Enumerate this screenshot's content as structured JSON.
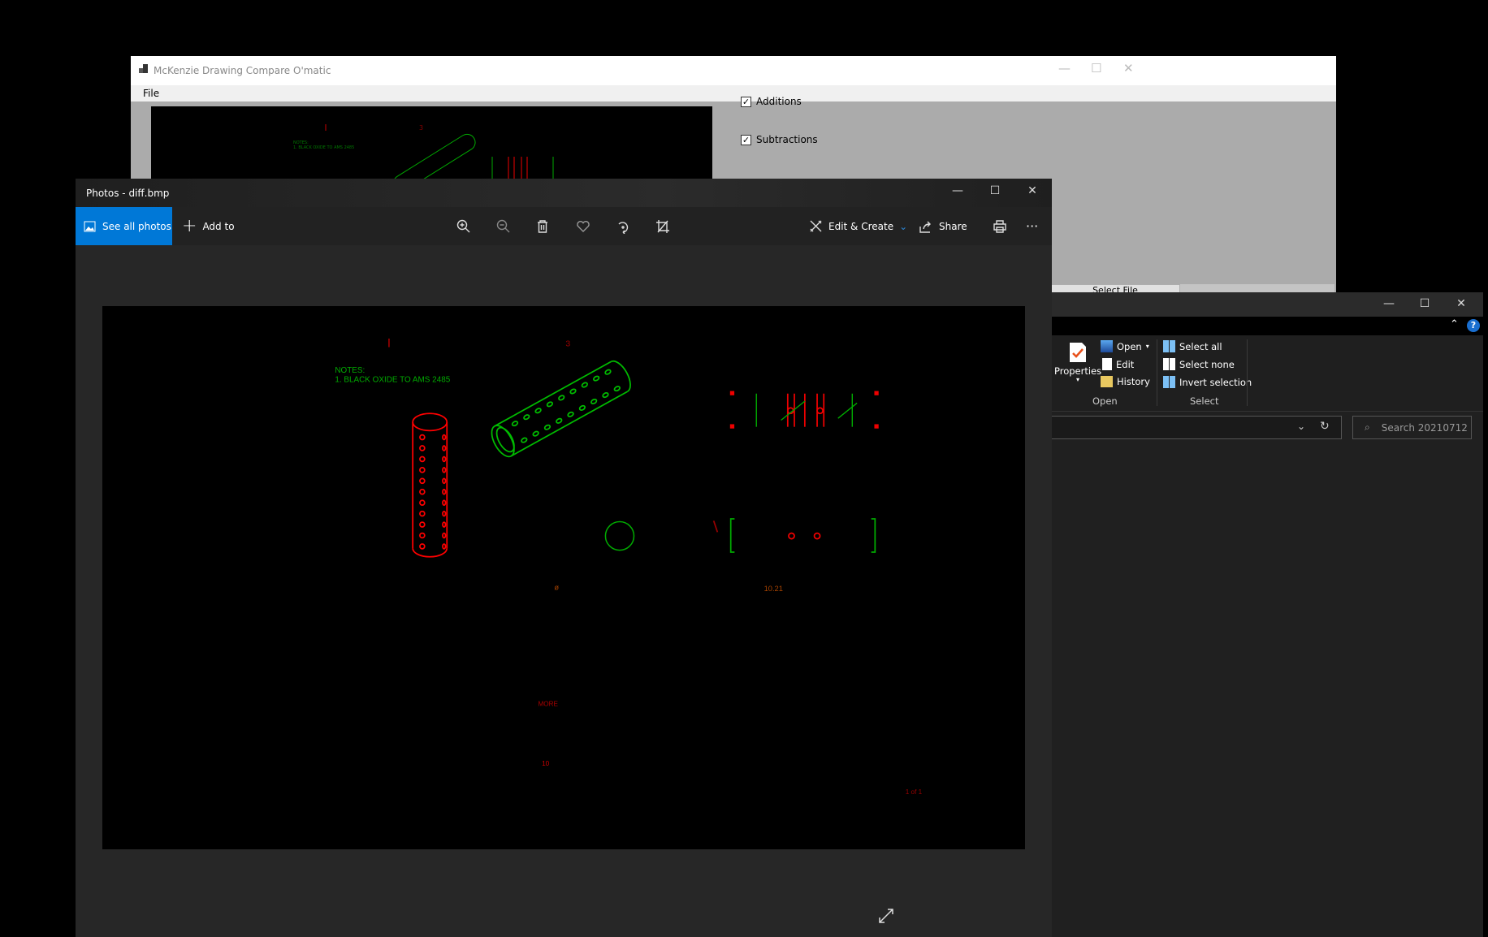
{
  "compare_app": {
    "title": "McKenzie Drawing Compare O'matic",
    "menu": [
      "File"
    ],
    "checkboxes": [
      {
        "label": "Additions",
        "checked": true
      },
      {
        "label": "Subtractions",
        "checked": true
      }
    ],
    "select_file_label": "Select File"
  },
  "photos": {
    "title": "Photos - diff.bmp",
    "see_all": "See all photos",
    "add_to": "Add to",
    "edit_create": "Edit & Create",
    "share": "Share",
    "more": "···",
    "accent": "#0078d7",
    "icons": [
      "zoom-in-icon",
      "zoom-out-icon",
      "delete-icon",
      "heart-icon",
      "rotate-icon",
      "crop-icon",
      "print-icon",
      "expand-icon"
    ]
  },
  "drawing": {
    "notes_title": "NOTES:",
    "note_1": "1. BLACK OXIDE TO AMS 2485",
    "mark_1": "|",
    "mark_3": "3",
    "dim": "10.21",
    "more": "MORE",
    "num": "10",
    "sheet": "1 of 1",
    "addition_color": "#00a000",
    "subtraction_color": "#e00000"
  },
  "explorer": {
    "ribbon": {
      "properties": "Properties",
      "open": "Open",
      "edit": "Edit",
      "history": "History",
      "select_all": "Select all",
      "select_none": "Select none",
      "invert_selection": "Invert selection",
      "group_open": "Open",
      "group_select": "Select"
    },
    "search_placeholder": "Search 20210712",
    "help": "?"
  }
}
